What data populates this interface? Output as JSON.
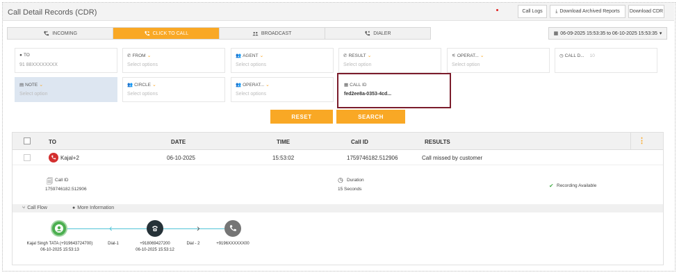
{
  "header": {
    "title": "Call Detail Records (CDR)",
    "buttons": {
      "call_logs": "Call Logs",
      "download_archived": "Download Archived Reports",
      "download_cdr": "Download CDR"
    }
  },
  "tabs": [
    {
      "label": "INCOMING",
      "icon": "incoming-call-icon",
      "active": false
    },
    {
      "label": "CLICK TO CALL",
      "icon": "click-to-call-icon",
      "active": true
    },
    {
      "label": "BROADCAST",
      "icon": "broadcast-icon",
      "active": false
    },
    {
      "label": "DIALER",
      "icon": "dialer-icon",
      "active": false
    }
  ],
  "date_range": "06-09-2025 15:53:35 to 06-10-2025 15:53:35",
  "filters": {
    "to": {
      "label": "TO",
      "value": "91 88XXXXXXXX"
    },
    "from": {
      "label": "FROM",
      "placeholder": "Select options"
    },
    "agent": {
      "label": "AGENT",
      "placeholder": "Select options"
    },
    "result": {
      "label": "RESULT",
      "placeholder": "Select option"
    },
    "operator1": {
      "label": "OPERAT...",
      "placeholder": "Select option"
    },
    "call_duration": {
      "label": "CALL D...",
      "value": "10"
    },
    "note": {
      "label": "NOTE",
      "placeholder": "Select option"
    },
    "circle": {
      "label": "CIRCLE",
      "placeholder": "Select options"
    },
    "operator2": {
      "label": "OPERAT...",
      "placeholder": "Select options"
    },
    "call_id": {
      "label": "CALL ID",
      "value": "fed2ee8a-0353-4cd..."
    }
  },
  "actions": {
    "reset": "RESET",
    "search": "SEARCH"
  },
  "table": {
    "columns": [
      "TO",
      "DATE",
      "TIME",
      "Call ID",
      "RESULTS"
    ],
    "row": {
      "to": "Kajal+2",
      "date": "06-10-2025",
      "time": "15:53:02",
      "call_id": "1759746182.512906",
      "result": "Call missed by customer"
    },
    "detail": {
      "call_id_label": "Call ID",
      "call_id_value": "1759746182.512906",
      "duration_label": "Duration",
      "duration_value": "15 Seconds",
      "recording": "Recording Available"
    },
    "flow_tabs": {
      "call_flow": "Call Flow",
      "more_info": "More Information"
    },
    "flow": {
      "node1_name": "Kajal Singh TATA (+919643724700)",
      "node1_time": "06-10-2025 15:53:13",
      "dial1": "Dial-1",
      "node2_name": "+918069427200",
      "node2_time": "06-10-2025 15:53:12",
      "dial2": "Dial - 2",
      "node3_name": "+9196XXXXXX00"
    }
  },
  "colors": {
    "accent": "#f9a825",
    "missed": "#d32f2f",
    "agent_green": "#4caf50",
    "flow_line": "#4fc3d7",
    "highlight_border": "#7b1c2b"
  }
}
